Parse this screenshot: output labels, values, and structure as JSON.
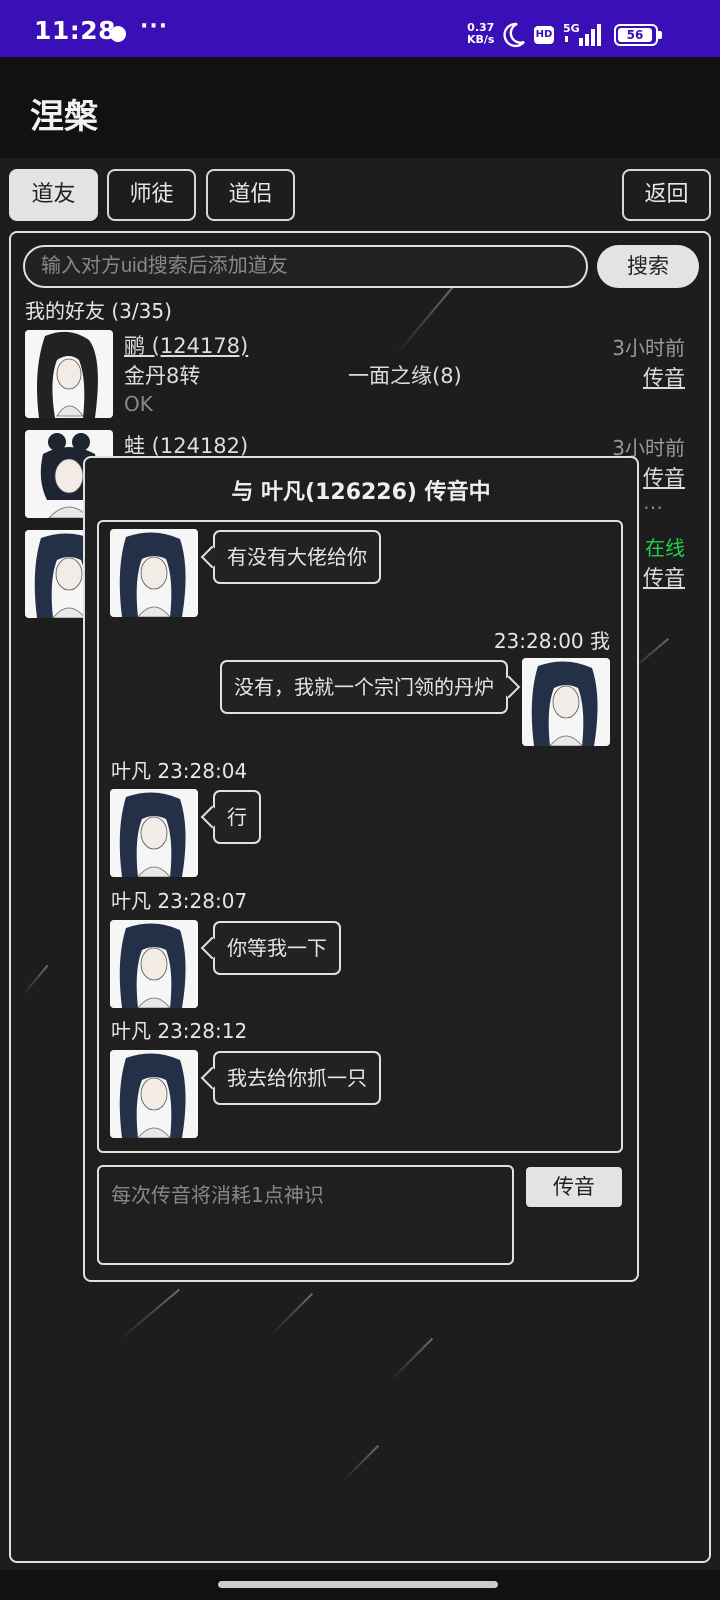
{
  "status_bar": {
    "time": "11:28",
    "more": "···",
    "net_speed_value": "0.37",
    "net_speed_unit": "KB/s",
    "hd": "HD",
    "network": "5G",
    "battery": "56"
  },
  "app": {
    "title": "涅槃"
  },
  "tabs": {
    "friends": "道友",
    "mentor": "师徒",
    "partner": "道侣",
    "back": "返回"
  },
  "search": {
    "placeholder": "输入对方uid搜索后添加道友",
    "button": "搜索"
  },
  "friends_list": {
    "heading": "我的好友 (3/35)",
    "items": [
      {
        "name": "鹂 (124178)",
        "rank": "金丹8转",
        "relation": "一面之缘(8)",
        "message": "OK",
        "time": "3小时前",
        "action": "传音"
      },
      {
        "name": "蛙 (124182)",
        "time": "3小时前",
        "action": "传音",
        "message_tail": "…"
      },
      {
        "time": "在线",
        "action": "传音"
      }
    ]
  },
  "dialog": {
    "title": "与 叶凡(126226) 传音中",
    "messages": [
      {
        "side": "left",
        "meta": "",
        "text": "有没有大佬给你"
      },
      {
        "side": "right",
        "meta": "23:28:00 我",
        "text": "没有，我就一个宗门领的丹炉"
      },
      {
        "side": "left",
        "meta": "叶凡 23:28:04",
        "text": "行"
      },
      {
        "side": "left",
        "meta": "叶凡 23:28:07",
        "text": "你等我一下"
      },
      {
        "side": "left",
        "meta": "叶凡 23:28:12",
        "text": "我去给你抓一只"
      }
    ],
    "compose_placeholder": "每次传音将消耗1点神识",
    "send_button": "传音"
  },
  "colors": {
    "status_bar": "#3a0fb8",
    "background": "#1d1d1d",
    "online": "#22d04a"
  }
}
